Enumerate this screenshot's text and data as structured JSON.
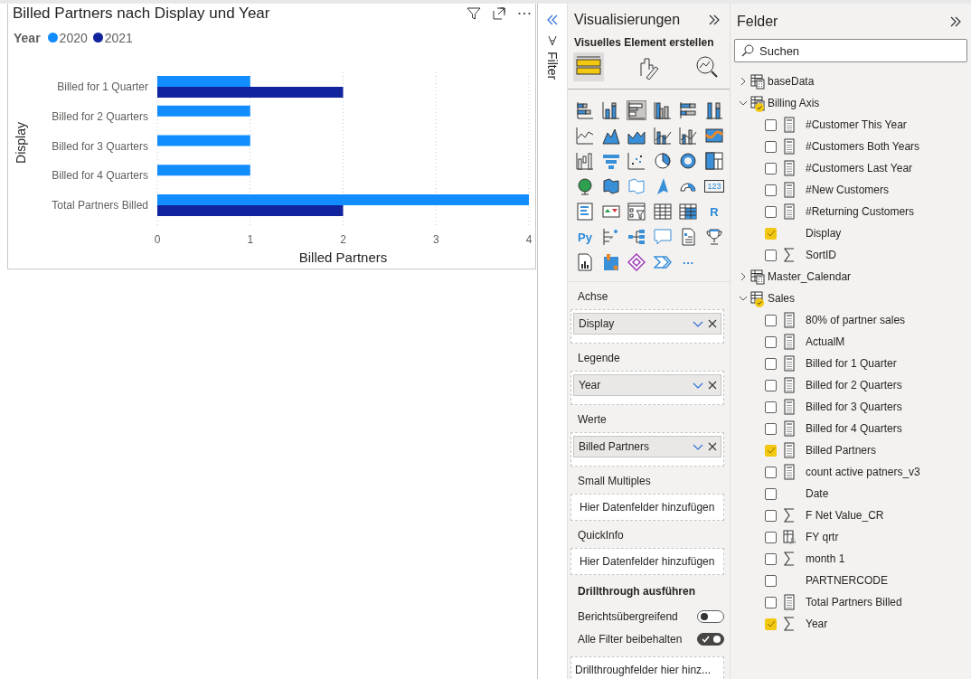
{
  "visual": {
    "title": "Billed Partners nach Display und Year",
    "legend_title": "Year",
    "chart_data": {
      "type": "bar",
      "orientation": "horizontal",
      "xlabel": "Billed Partners",
      "ylabel": "Display",
      "categories": [
        "Billed for 1 Quarter",
        "Billed for 2 Quarters",
        "Billed for 3 Quarters",
        "Billed for 4 Quarters",
        "Total Partners Billed"
      ],
      "series": [
        {
          "name": "2020",
          "color": "#118dff",
          "values": [
            1,
            1,
            1,
            1,
            4
          ]
        },
        {
          "name": "2021",
          "color": "#12239e",
          "values": [
            2,
            null,
            null,
            null,
            2
          ]
        }
      ],
      "xlim": [
        0,
        4
      ],
      "xticks": [
        0,
        1,
        2,
        3,
        4
      ],
      "grid": true
    }
  },
  "filter_pane": {
    "label": "Filter"
  },
  "visualizations": {
    "title": "Visualisierungen",
    "subtitle": "Visuelles Element erstellen",
    "tabs": [
      {
        "kind": "fields",
        "selected": true
      },
      {
        "kind": "format",
        "selected": false
      },
      {
        "kind": "analytics",
        "selected": false
      }
    ],
    "visual_types": [
      {
        "kind": "stacked-bar",
        "selected": false
      },
      {
        "kind": "stacked-column",
        "selected": false
      },
      {
        "kind": "clustered-bar",
        "selected": true
      },
      {
        "kind": "clustered-column",
        "selected": false
      },
      {
        "kind": "full-bar",
        "selected": false
      },
      {
        "kind": "full-column",
        "selected": false
      },
      {
        "kind": "line",
        "selected": false
      },
      {
        "kind": "area",
        "selected": false
      },
      {
        "kind": "stacked-area",
        "selected": false
      },
      {
        "kind": "line-column",
        "selected": false
      },
      {
        "kind": "line-column-alt",
        "selected": false
      },
      {
        "kind": "ribbon",
        "selected": false
      },
      {
        "kind": "waterfall",
        "selected": false
      },
      {
        "kind": "funnel",
        "selected": false
      },
      {
        "kind": "scatter",
        "selected": false
      },
      {
        "kind": "pie",
        "selected": false
      },
      {
        "kind": "donut",
        "selected": false
      },
      {
        "kind": "treemap",
        "selected": false
      },
      {
        "kind": "globe",
        "selected": false
      },
      {
        "kind": "filled-map",
        "selected": false
      },
      {
        "kind": "shape-map",
        "selected": false
      },
      {
        "kind": "arrow",
        "selected": false
      },
      {
        "kind": "gauge",
        "selected": false
      },
      {
        "kind": "card",
        "selected": false,
        "label": "123"
      },
      {
        "kind": "list-card",
        "selected": false
      },
      {
        "kind": "kpi",
        "selected": false
      },
      {
        "kind": "slicer",
        "selected": false
      },
      {
        "kind": "table",
        "selected": false
      },
      {
        "kind": "matrix",
        "selected": false
      },
      {
        "kind": "text",
        "selected": false,
        "label": "R"
      },
      {
        "kind": "text",
        "selected": false,
        "label": "Py"
      },
      {
        "kind": "influencers",
        "selected": false
      },
      {
        "kind": "tree",
        "selected": false
      },
      {
        "kind": "speech-bubble",
        "selected": false
      },
      {
        "kind": "document",
        "selected": false
      },
      {
        "kind": "trophy",
        "selected": false
      },
      {
        "kind": "report",
        "selected": false
      },
      {
        "kind": "map-pin",
        "selected": false
      },
      {
        "kind": "diamond",
        "selected": false
      },
      {
        "kind": "chevron",
        "selected": false
      },
      {
        "kind": "text",
        "selected": false,
        "label": "···"
      }
    ],
    "wells": [
      {
        "label": "Achse",
        "kind": "field",
        "value": "Display"
      },
      {
        "label": "Legende",
        "kind": "field",
        "value": "Year"
      },
      {
        "label": "Werte",
        "kind": "field",
        "value": "Billed Partners"
      },
      {
        "label": "Small Multiples",
        "kind": "empty",
        "placeholder": "Hier Datenfelder hinzufügen"
      },
      {
        "label": "QuickInfo",
        "kind": "empty",
        "placeholder": "Hier Datenfelder hinzufügen"
      }
    ],
    "drillthrough": {
      "title": "Drillthrough ausführen",
      "toggles": [
        {
          "label": "Berichtsübergreifend",
          "on": false
        },
        {
          "label": "Alle Filter beibehalten",
          "on": true
        }
      ],
      "placeholder": "Drillthroughfelder hier hinz..."
    }
  },
  "fields": {
    "title": "Felder",
    "search": {
      "placeholder": "Suchen"
    },
    "tables": [
      {
        "name": "baseData",
        "kind": "calculated",
        "expanded": false,
        "in_use": false
      },
      {
        "name": "Billing Axis",
        "kind": "calculated",
        "expanded": true,
        "in_use": true,
        "children": [
          {
            "name": "#Customer This Year",
            "kind": "measure",
            "checked": false
          },
          {
            "name": "#Customers Both Years",
            "kind": "measure",
            "checked": false
          },
          {
            "name": "#Customers Last Year",
            "kind": "measure",
            "checked": false
          },
          {
            "name": "#New Customers",
            "kind": "measure",
            "checked": false
          },
          {
            "name": "#Returning Customers",
            "kind": "measure",
            "checked": false
          },
          {
            "name": "Display",
            "kind": "plain",
            "checked": true
          },
          {
            "name": "SortID",
            "kind": "sum",
            "checked": false
          }
        ]
      },
      {
        "name": "Master_Calendar",
        "kind": "calculated",
        "expanded": false,
        "in_use": false
      },
      {
        "name": "Sales",
        "kind": "table",
        "expanded": true,
        "in_use": true,
        "children": [
          {
            "name": "80% of partner sales",
            "kind": "measure",
            "checked": false
          },
          {
            "name": "ActualM",
            "kind": "measure",
            "checked": false
          },
          {
            "name": "Billed for 1 Quarter",
            "kind": "measure",
            "checked": false
          },
          {
            "name": "Billed for 2 Quarters",
            "kind": "measure",
            "checked": false
          },
          {
            "name": "Billed for 3 Quarters",
            "kind": "measure",
            "checked": false
          },
          {
            "name": "Billed for 4 Quarters",
            "kind": "measure",
            "checked": false
          },
          {
            "name": "Billed Partners",
            "kind": "measure",
            "checked": true
          },
          {
            "name": "count active patners_v3",
            "kind": "measure",
            "checked": false
          },
          {
            "name": "Date",
            "kind": "plain",
            "checked": false
          },
          {
            "name": "F Net Value_CR",
            "kind": "sum",
            "checked": false
          },
          {
            "name": "FY qrtr",
            "kind": "calc-column",
            "checked": false
          },
          {
            "name": "month 1",
            "kind": "sum",
            "checked": false
          },
          {
            "name": "PARTNERCODE",
            "kind": "plain",
            "checked": false
          },
          {
            "name": "Total Partners Billed",
            "kind": "measure",
            "checked": false
          },
          {
            "name": "Year",
            "kind": "sum",
            "checked": true
          }
        ]
      }
    ]
  }
}
